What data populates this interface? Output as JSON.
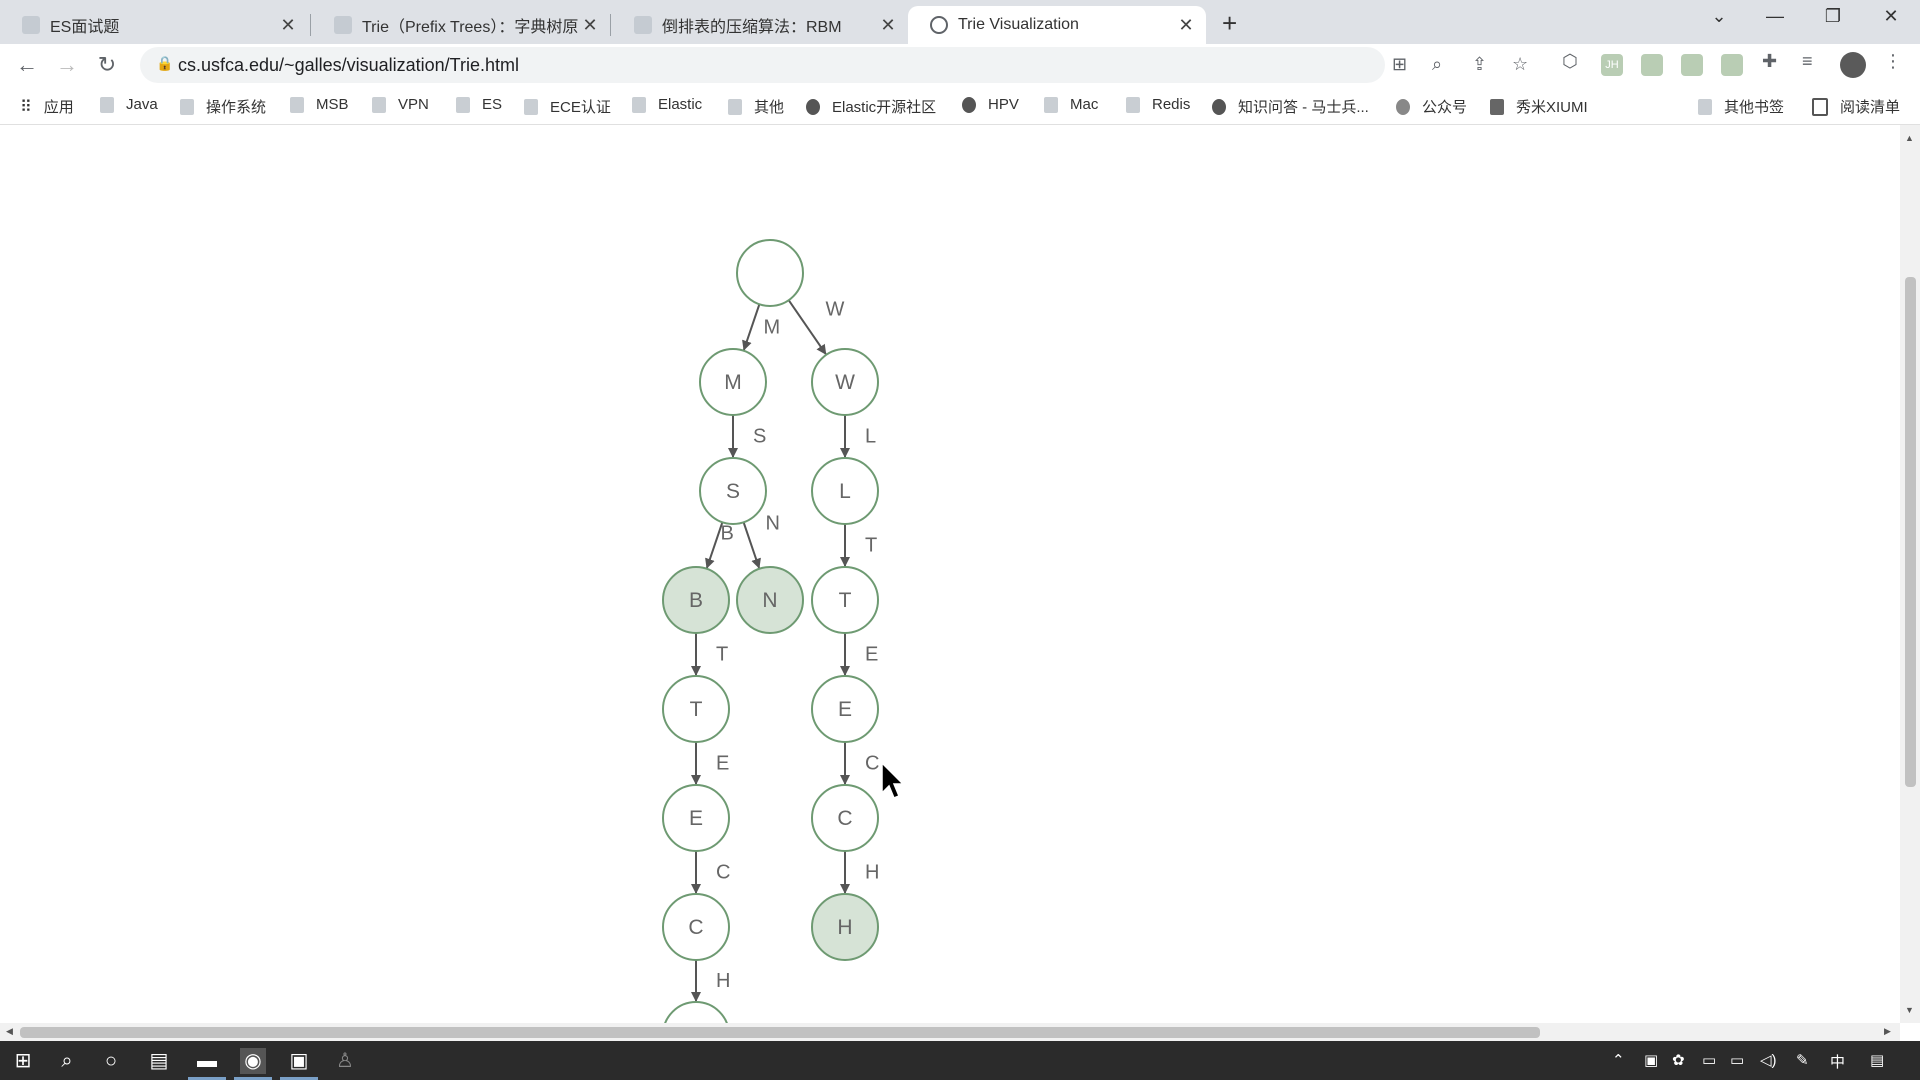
{
  "tabs": [
    {
      "label": "ES面试题",
      "active": false
    },
    {
      "label": "Trie（Prefix Trees）：字典树原",
      "active": false
    },
    {
      "label": "倒排表的压缩算法：RBM",
      "active": false
    },
    {
      "label": "Trie Visualization",
      "active": true
    }
  ],
  "window_controls": {
    "dropdown": "⌄",
    "minimize": "—",
    "restore": "❐",
    "close": "✕"
  },
  "address_bar": {
    "url": "cs.usfca.edu/~galles/visualization/Trie.html"
  },
  "toolbar_icons": [
    "translate-icon",
    "zoom-icon",
    "share-icon",
    "star-icon",
    "extension-icon",
    "jh-extension-icon",
    "extension-icon",
    "extension-icon",
    "extension-icon",
    "puzzle-icon",
    "reading-list-icon",
    "profile-avatar",
    "menu-icon"
  ],
  "bookmarks": [
    {
      "label": "应用"
    },
    {
      "label": "Java"
    },
    {
      "label": "操作系统"
    },
    {
      "label": "MSB"
    },
    {
      "label": "VPN"
    },
    {
      "label": "ES"
    },
    {
      "label": "ECE认证"
    },
    {
      "label": "Elastic"
    },
    {
      "label": "其他"
    },
    {
      "label": "Elastic开源社区"
    },
    {
      "label": "HPV"
    },
    {
      "label": "Mac"
    },
    {
      "label": "Redis"
    },
    {
      "label": "知识问答 - 马士兵..."
    },
    {
      "label": "公众号"
    },
    {
      "label": "秀米XIUMI"
    },
    {
      "label": "其他书签"
    },
    {
      "label": "阅读清单"
    }
  ],
  "trie": {
    "nodes": [
      {
        "id": "root",
        "label": "",
        "terminal": false
      },
      {
        "id": "m",
        "label": "M",
        "terminal": false
      },
      {
        "id": "w",
        "label": "W",
        "terminal": false
      },
      {
        "id": "ms",
        "label": "S",
        "terminal": false
      },
      {
        "id": "wl",
        "label": "L",
        "terminal": false
      },
      {
        "id": "msb",
        "label": "B",
        "terminal": true
      },
      {
        "id": "msn",
        "label": "N",
        "terminal": true
      },
      {
        "id": "wlt",
        "label": "T",
        "terminal": false
      },
      {
        "id": "msbt",
        "label": "T",
        "terminal": false
      },
      {
        "id": "wlte",
        "label": "E",
        "terminal": false
      },
      {
        "id": "msbte",
        "label": "E",
        "terminal": false
      },
      {
        "id": "wltec",
        "label": "C",
        "terminal": false
      },
      {
        "id": "msbtec",
        "label": "C",
        "terminal": false
      },
      {
        "id": "wltech",
        "label": "H",
        "terminal": true
      },
      {
        "id": "msbtech",
        "label": "",
        "terminal": false
      }
    ],
    "edges": [
      {
        "from": "root",
        "to": "m",
        "label": "M"
      },
      {
        "from": "root",
        "to": "w",
        "label": "W"
      },
      {
        "from": "m",
        "to": "ms",
        "label": "S"
      },
      {
        "from": "w",
        "to": "wl",
        "label": "L"
      },
      {
        "from": "ms",
        "to": "msb",
        "label": "B"
      },
      {
        "from": "ms",
        "to": "msn",
        "label": "N"
      },
      {
        "from": "wl",
        "to": "wlt",
        "label": "T"
      },
      {
        "from": "msb",
        "to": "msbt",
        "label": "T"
      },
      {
        "from": "wlt",
        "to": "wlte",
        "label": "E"
      },
      {
        "from": "msbt",
        "to": "msbte",
        "label": "E"
      },
      {
        "from": "wlte",
        "to": "wltec",
        "label": "C"
      },
      {
        "from": "msbte",
        "to": "msbtec",
        "label": "C"
      },
      {
        "from": "wltec",
        "to": "wltech",
        "label": "H"
      },
      {
        "from": "msbtec",
        "to": "msbtech",
        "label": "H"
      }
    ]
  },
  "colors": {
    "node_stroke": "#6e9a72",
    "terminal_fill": "#d6e3d6",
    "edge": "#555555",
    "text": "#666666"
  },
  "taskbar": {
    "ime": "中",
    "icons": [
      "windows-icon",
      "search-icon",
      "cortana-icon",
      "task-view-icon",
      "explorer-icon",
      "browser-icon",
      "app-icon",
      "app-icon"
    ]
  }
}
